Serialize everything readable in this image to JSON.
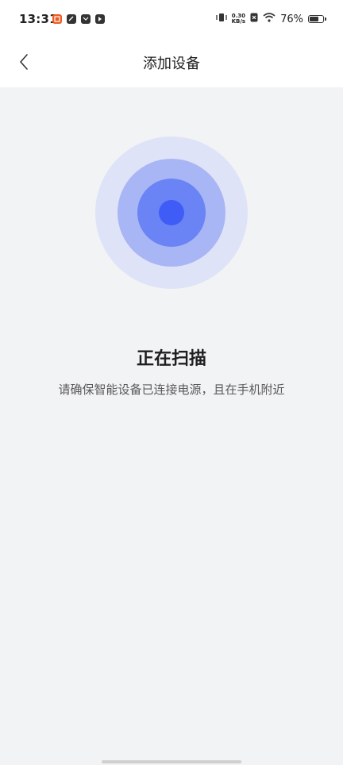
{
  "status_bar": {
    "time": "13:31",
    "notification_icons": [
      "app-badge-icon",
      "link-app-icon",
      "mail-app-icon",
      "media-app-icon"
    ],
    "net_speed_value": "0.30",
    "net_speed_unit": "KB/s",
    "battery_percent": "76%",
    "battery_level": 0.76
  },
  "header": {
    "title": "添加设备",
    "back_icon": "chevron-left-icon"
  },
  "scan": {
    "title": "正在扫描",
    "hint": "请确保智能设备已连接电源，且在手机附近"
  },
  "colors": {
    "ring_outer": "#dfe3f7",
    "ring_mid": "#a9b6f5",
    "ring_inner": "#6a84f6",
    "ring_core": "#3f5df6",
    "background": "#f2f3f5"
  }
}
